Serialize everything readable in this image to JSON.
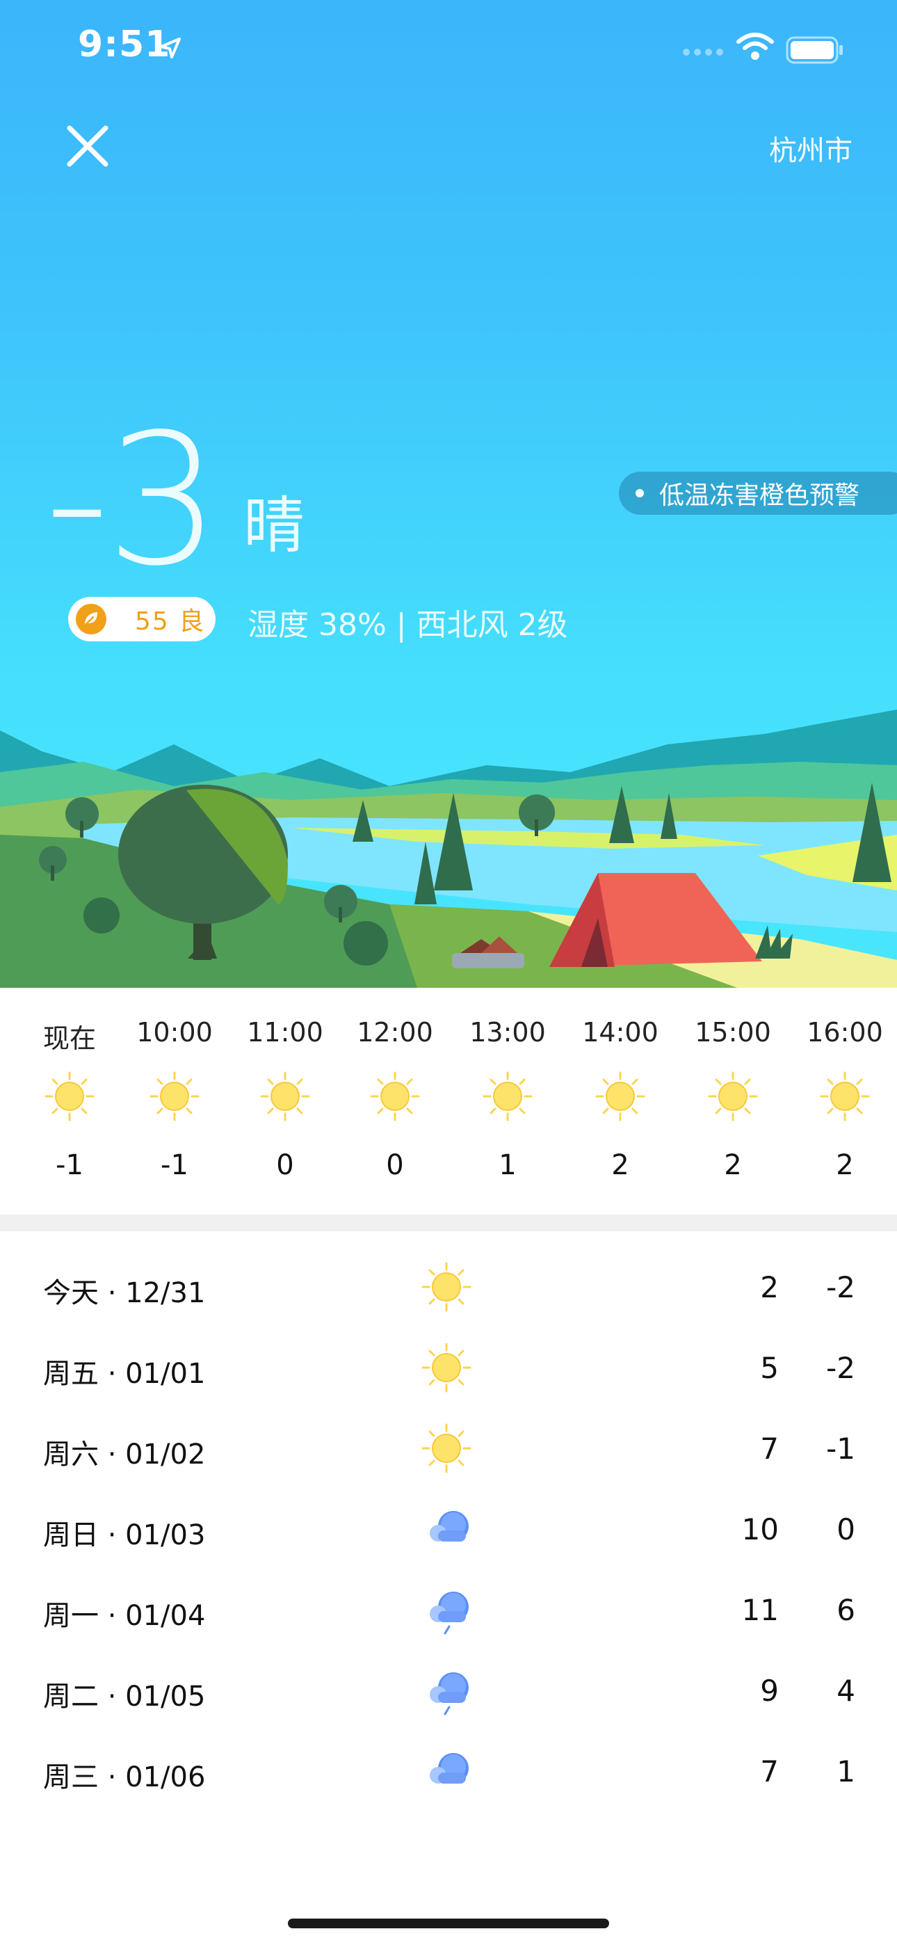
{
  "status_bar": {
    "time": "9:51",
    "icons": [
      "location-arrow-icon",
      "signal-icon",
      "wifi-icon",
      "battery-icon"
    ]
  },
  "header": {
    "close_icon": "close-icon",
    "city": "杭州市"
  },
  "current": {
    "temperature": "-3",
    "condition": "晴",
    "alert": "低温冻害橙色预警",
    "aqi_value": "55 良",
    "details": "湿度 38% | 西北风 2级"
  },
  "hourly": [
    {
      "time": "现在",
      "icon": "sun-icon",
      "temp": "-1"
    },
    {
      "time": "10:00",
      "icon": "sun-icon",
      "temp": "-1"
    },
    {
      "time": "11:00",
      "icon": "sun-icon",
      "temp": "0"
    },
    {
      "time": "12:00",
      "icon": "sun-icon",
      "temp": "0"
    },
    {
      "time": "13:00",
      "icon": "sun-icon",
      "temp": "1"
    },
    {
      "time": "14:00",
      "icon": "sun-icon",
      "temp": "2"
    },
    {
      "time": "15:00",
      "icon": "sun-icon",
      "temp": "2"
    },
    {
      "time": "16:00",
      "icon": "sun-icon",
      "temp": "2"
    }
  ],
  "daily": [
    {
      "label": "今天 · 12/31",
      "icon": "sun-icon",
      "high": "2",
      "low": "-2"
    },
    {
      "label": "周五 · 01/01",
      "icon": "sun-icon",
      "high": "5",
      "low": "-2"
    },
    {
      "label": "周六 · 01/02",
      "icon": "sun-icon",
      "high": "7",
      "low": "-1"
    },
    {
      "label": "周日 · 01/03",
      "icon": "cloud-icon",
      "high": "10",
      "low": "0"
    },
    {
      "label": "周一 · 01/04",
      "icon": "cloud-rain-icon",
      "high": "11",
      "low": "6"
    },
    {
      "label": "周二 · 01/05",
      "icon": "cloud-rain-icon",
      "high": "9",
      "low": "4"
    },
    {
      "label": "周三 · 01/06",
      "icon": "cloud-icon",
      "high": "7",
      "low": "1"
    }
  ],
  "colors": {
    "sky_top": "#3bb5fb",
    "sky_bottom": "#49e6fd",
    "aqi_accent": "#f0a019",
    "tent": "#f06458"
  }
}
